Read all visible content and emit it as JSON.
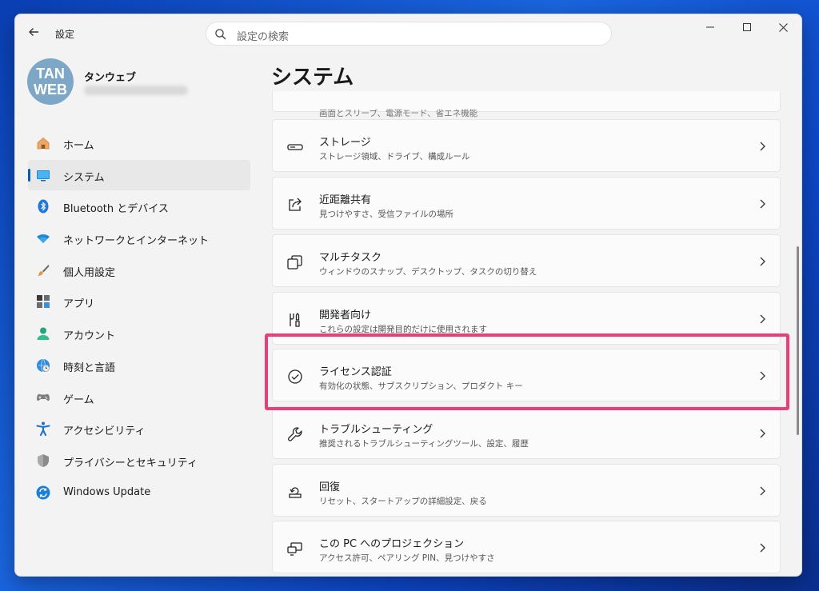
{
  "window": {
    "app_title": "設定",
    "search_placeholder": "設定の検索"
  },
  "profile": {
    "avatar_line1": "TAN",
    "avatar_line2": "WEB",
    "name": "タンウェブ"
  },
  "sidebar": {
    "items": [
      {
        "label": "ホーム",
        "icon": "home-icon"
      },
      {
        "label": "システム",
        "icon": "system-icon",
        "active": true
      },
      {
        "label": "Bluetooth とデバイス",
        "icon": "bluetooth-icon"
      },
      {
        "label": "ネットワークとインターネット",
        "icon": "wifi-icon"
      },
      {
        "label": "個人用設定",
        "icon": "brush-icon"
      },
      {
        "label": "アプリ",
        "icon": "apps-icon"
      },
      {
        "label": "アカウント",
        "icon": "account-icon"
      },
      {
        "label": "時刻と言語",
        "icon": "time-language-icon"
      },
      {
        "label": "ゲーム",
        "icon": "gamepad-icon"
      },
      {
        "label": "アクセシビリティ",
        "icon": "accessibility-icon"
      },
      {
        "label": "プライバシーとセキュリティ",
        "icon": "shield-icon"
      },
      {
        "label": "Windows Update",
        "icon": "windows-update-icon"
      }
    ]
  },
  "main": {
    "page_title": "システム",
    "partial_subtitle": "画面とスリープ、電源モード、省エネ機能",
    "cards": [
      {
        "title": "ストレージ",
        "subtitle": "ストレージ領域、ドライブ、構成ルール",
        "icon": "storage-icon"
      },
      {
        "title": "近距離共有",
        "subtitle": "見つけやすさ、受信ファイルの場所",
        "icon": "nearby-share-icon"
      },
      {
        "title": "マルチタスク",
        "subtitle": "ウィンドウのスナップ、デスクトップ、タスクの切り替え",
        "icon": "multitask-icon"
      },
      {
        "title": "開発者向け",
        "subtitle": "これらの設定は開発目的だけに使用されます",
        "icon": "developer-icon"
      },
      {
        "title": "ライセンス認証",
        "subtitle": "有効化の状態、サブスクリプション、プロダクト キー",
        "icon": "activation-check-icon",
        "highlighted": true
      },
      {
        "title": "トラブルシューティング",
        "subtitle": "推奨されるトラブルシューティングツール、設定、履歴",
        "icon": "wrench-icon"
      },
      {
        "title": "回復",
        "subtitle": "リセット、スタートアップの詳細設定、戻る",
        "icon": "recovery-icon"
      },
      {
        "title": "この PC へのプロジェクション",
        "subtitle": "アクセス許可、ペアリング PIN、見つけやすさ",
        "icon": "projection-icon"
      }
    ]
  },
  "colors": {
    "accent": "#005fb8",
    "highlight_box": "#e83e7a",
    "window_bg": "#f3f3f3"
  }
}
